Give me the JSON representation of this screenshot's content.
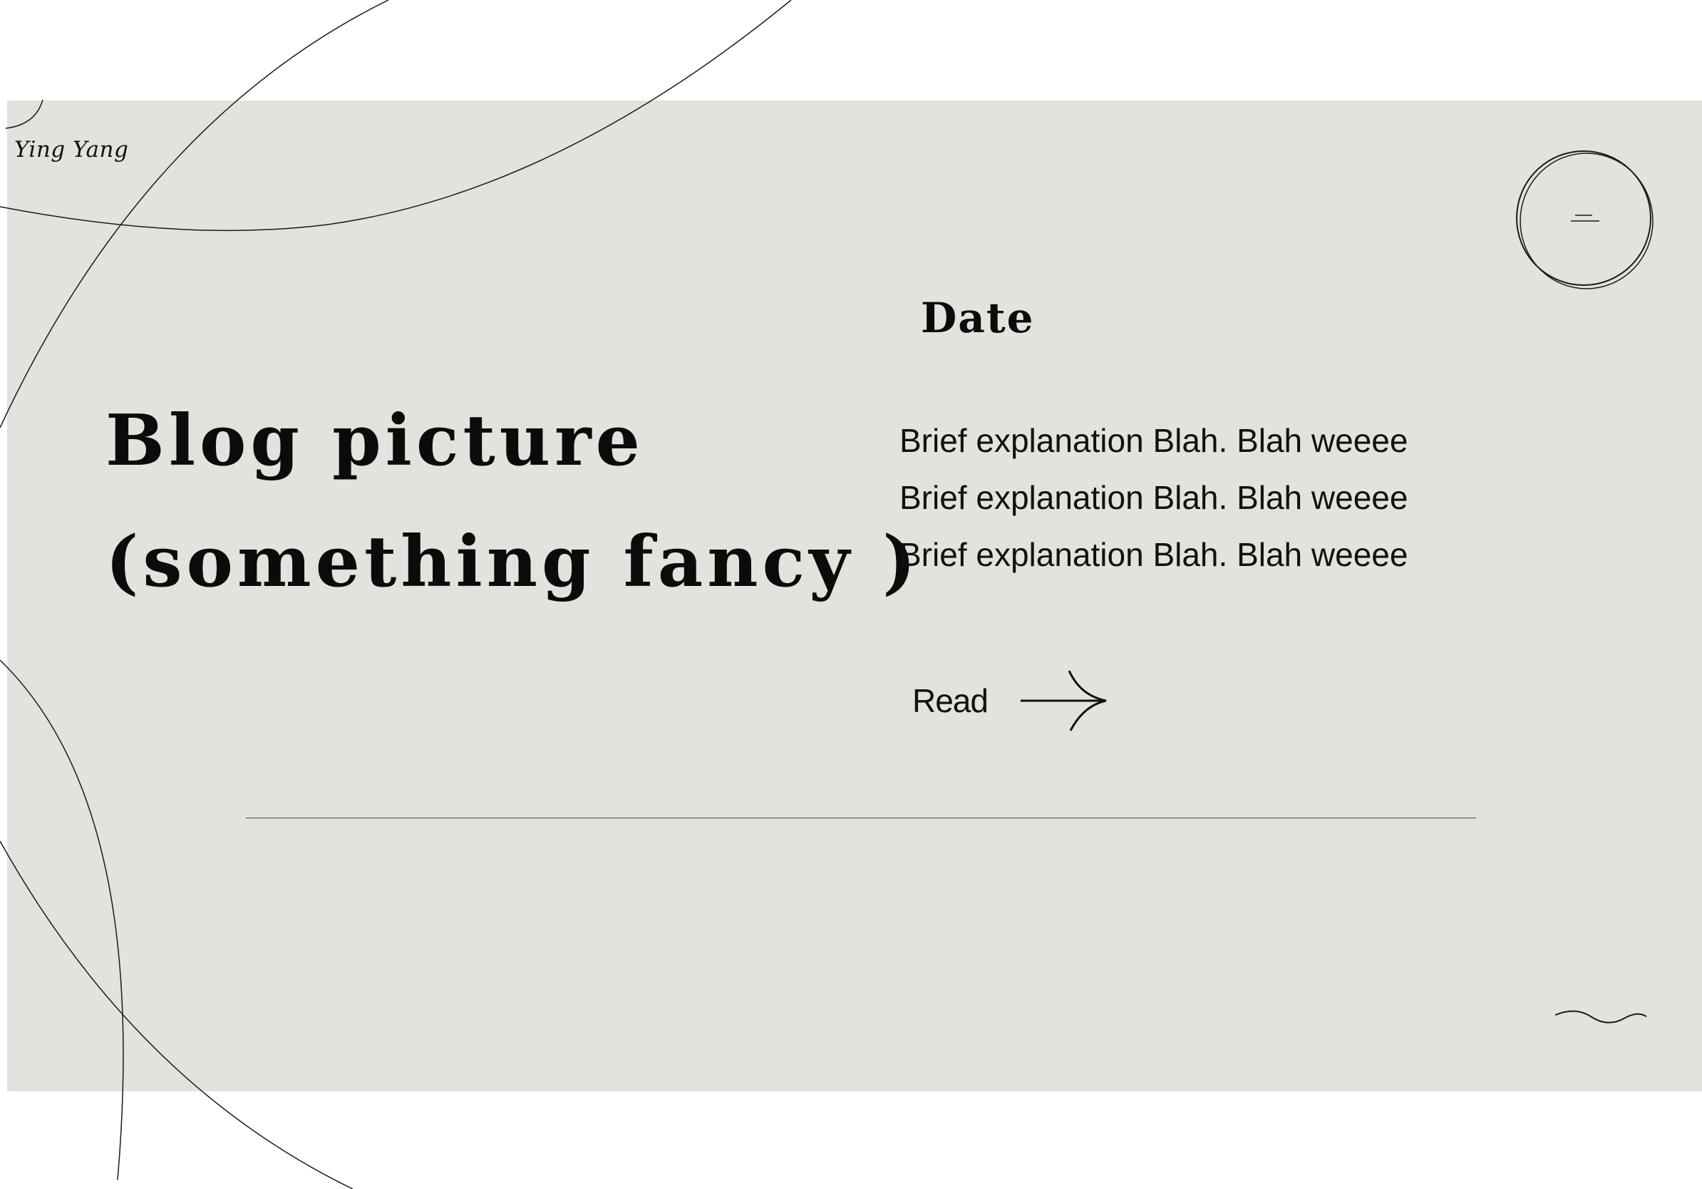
{
  "brand": {
    "name": "Ying Yang"
  },
  "hero": {
    "title_line1": "Blog picture",
    "title_line2": "(something fancy )"
  },
  "post": {
    "date": "Date",
    "description_lines": [
      "Brief explanation Blah. Blah weeee",
      "Brief explanation Blah. Blah weeee",
      "Brief explanation Blah. Blah weeee"
    ],
    "read_label": "Read"
  },
  "icons": {
    "menu": "menu-icon",
    "read_arrow": "arrow-right-icon",
    "tilde": "tilde-icon"
  },
  "colors": {
    "card_background": "#e3e2dc",
    "page_background": "#ffffff",
    "text": "#111111"
  }
}
